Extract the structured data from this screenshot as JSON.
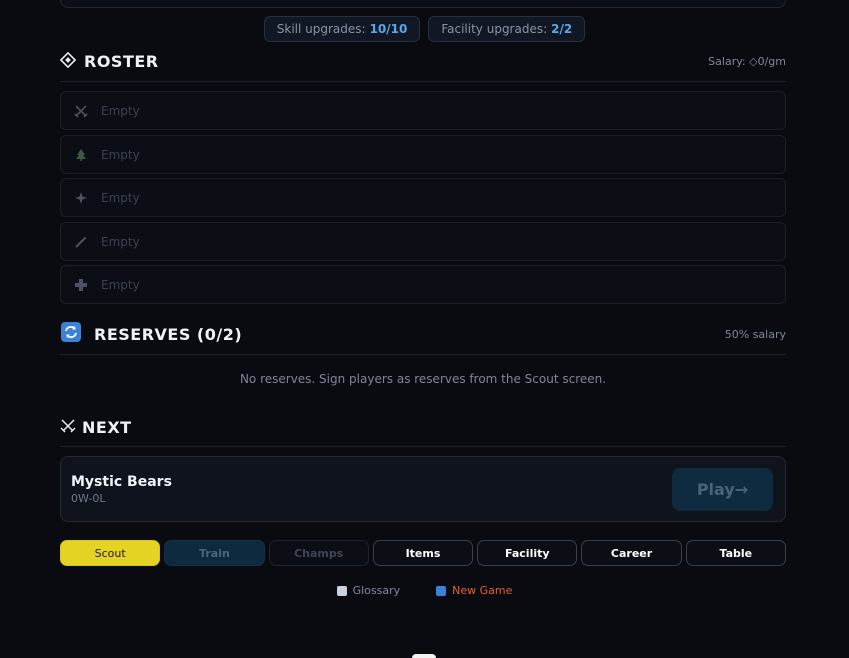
{
  "upgrades": {
    "skill_label": "Skill upgrades:",
    "skill_value": "10/10",
    "facility_label": "Facility upgrades:",
    "facility_value": "2/2"
  },
  "roster": {
    "title": "ROSTER",
    "salary": "Salary: ◇0/gm",
    "slots": [
      {
        "icon": "crossed-swords-icon",
        "label": "Empty"
      },
      {
        "icon": "tree-icon",
        "label": "Empty"
      },
      {
        "icon": "sparkle-icon",
        "label": "Empty"
      },
      {
        "icon": "wand-icon",
        "label": "Empty"
      },
      {
        "icon": "cross-icon",
        "label": "Empty"
      }
    ]
  },
  "reserves": {
    "title": "RESERVES (0/2)",
    "note": "50% salary",
    "empty_text": "No reserves. Sign players as reserves from the Scout screen."
  },
  "next": {
    "title": "NEXT",
    "opponent": "Mystic Bears",
    "record": "0W-0L",
    "play_label": "Play→"
  },
  "nav": {
    "scout": "Scout",
    "train": "Train",
    "champs": "Champs",
    "items": "Items",
    "facility": "Facility",
    "career": "Career",
    "table": "Table"
  },
  "footer": {
    "glossary": "Glossary",
    "new_game": "New Game"
  },
  "colors": {
    "accent_yellow": "#e5d324",
    "link_orange": "#e3612b",
    "value_blue": "#5aa6ea",
    "background": "#090b10"
  }
}
